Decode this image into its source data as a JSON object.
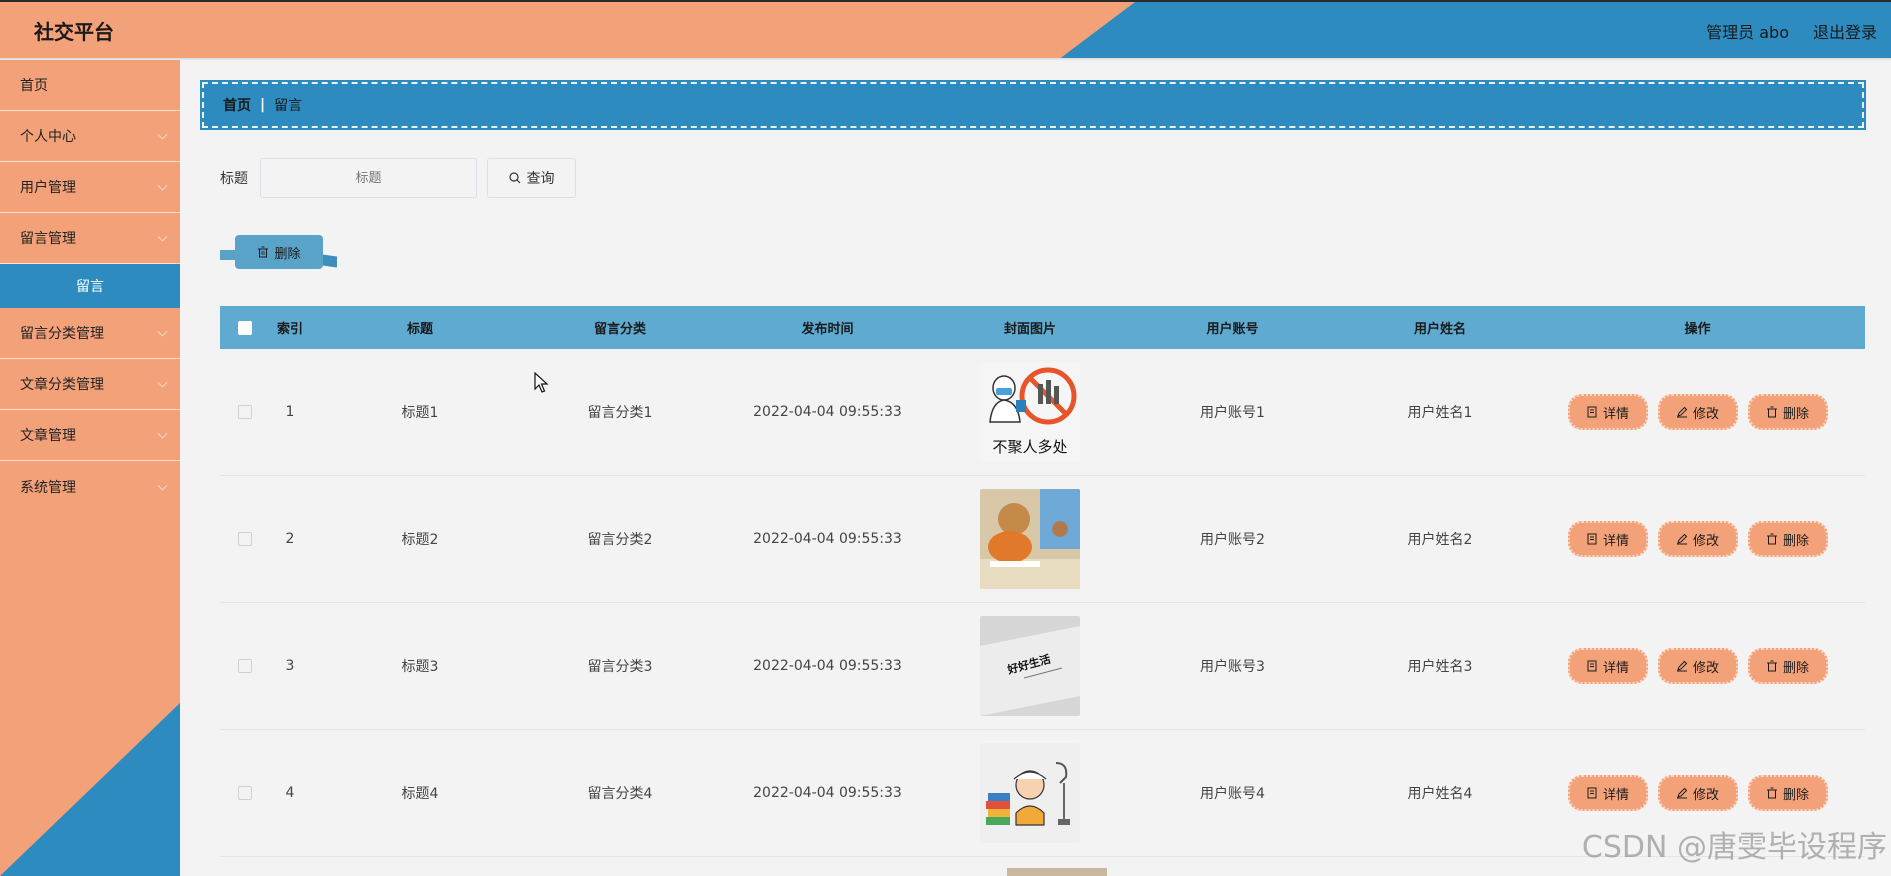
{
  "header": {
    "title": "社交平台",
    "admin": "管理员 abo",
    "logout": "退出登录"
  },
  "sidebar": {
    "items": [
      {
        "label": "首页",
        "chevron": false
      },
      {
        "label": "个人中心",
        "chevron": true
      },
      {
        "label": "用户管理",
        "chevron": true
      },
      {
        "label": "留言管理",
        "chevron": true
      }
    ],
    "active_sub": "留言",
    "items2": [
      {
        "label": "留言分类管理"
      },
      {
        "label": "文章分类管理"
      },
      {
        "label": "文章管理"
      },
      {
        "label": "系统管理"
      }
    ]
  },
  "breadcrumb": {
    "home": "首页",
    "sep": "|",
    "current": "留言"
  },
  "search": {
    "label": "标题",
    "placeholder": "标题",
    "button": "查询"
  },
  "toolbar": {
    "delete_label": "删除"
  },
  "table": {
    "headers": {
      "index": "索引",
      "title": "标题",
      "category": "留言分类",
      "time": "发布时间",
      "image": "封面图片",
      "account": "用户账号",
      "name": "用户姓名",
      "ops": "操作"
    },
    "ops": {
      "detail": "详情",
      "edit": "修改",
      "delete": "删除"
    },
    "rows": [
      {
        "index": "1",
        "title": "标题1",
        "category": "留言分类1",
        "time": "2022-04-04 09:55:33",
        "account": "用户账号1",
        "name": "用户姓名1",
        "image_caption": "不聚人多处"
      },
      {
        "index": "2",
        "title": "标题2",
        "category": "留言分类2",
        "time": "2022-04-04 09:55:33",
        "account": "用户账号2",
        "name": "用户姓名2"
      },
      {
        "index": "3",
        "title": "标题3",
        "category": "留言分类3",
        "time": "2022-04-04 09:55:33",
        "account": "用户账号3",
        "name": "用户姓名3",
        "image_caption": "好好生活"
      },
      {
        "index": "4",
        "title": "标题4",
        "category": "留言分类4",
        "time": "2022-04-04 09:55:33",
        "account": "用户账号4",
        "name": "用户姓名4"
      }
    ]
  },
  "watermark": "CSDN @唐雯毕设程序",
  "colors": {
    "orange": "#f3a179",
    "blue": "#2d8bc0",
    "table_header": "#5eaad0"
  }
}
